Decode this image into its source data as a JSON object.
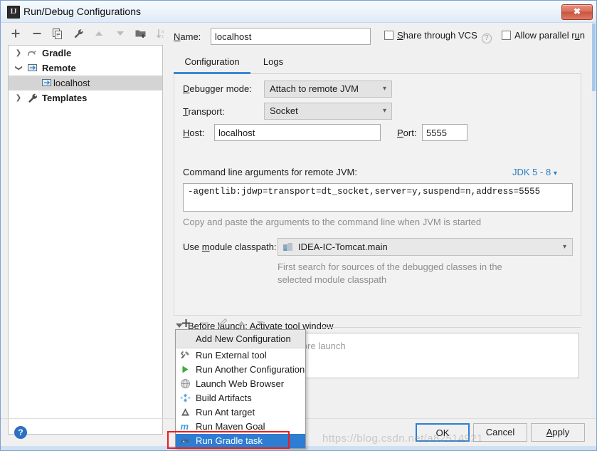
{
  "window": {
    "title": "Run/Debug Configurations",
    "app_icon": "IJ",
    "close_label": "✖"
  },
  "left_toolbar": {
    "buttons": [
      {
        "name": "add-configuration-button",
        "icon": "plus-icon",
        "glyph": "+",
        "enabled": true
      },
      {
        "name": "remove-configuration-button",
        "icon": "minus-icon",
        "glyph": "−",
        "enabled": true
      },
      {
        "name": "copy-configuration-button",
        "icon": "copy-icon",
        "glyph": "",
        "enabled": true
      },
      {
        "name": "edit-templates-button",
        "icon": "wrench-icon",
        "glyph": "",
        "enabled": true
      },
      {
        "name": "move-up-button",
        "icon": "arrow-up-icon",
        "glyph": "▲",
        "enabled": false
      },
      {
        "name": "move-down-button",
        "icon": "arrow-down-icon",
        "glyph": "▼",
        "enabled": false
      },
      {
        "name": "new-folder-button",
        "icon": "folder-add-icon",
        "glyph": "",
        "enabled": true
      },
      {
        "name": "sort-alphabetically-button",
        "icon": "sort-az-icon",
        "glyph": "",
        "enabled": false
      }
    ]
  },
  "tree": {
    "items": [
      {
        "label": "Gradle",
        "icon": "gradle-elephant-icon",
        "expander": "collapsed",
        "depth": 0,
        "bold": true,
        "selected": false
      },
      {
        "label": "Remote",
        "icon": "remote-icon",
        "expander": "expanded",
        "depth": 0,
        "bold": true,
        "selected": false
      },
      {
        "label": "localhost",
        "icon": "remote-icon",
        "expander": "none",
        "depth": 1,
        "bold": false,
        "selected": true
      },
      {
        "label": "Templates",
        "icon": "wrench-icon",
        "expander": "collapsed",
        "depth": 0,
        "bold": true,
        "selected": false
      }
    ]
  },
  "header": {
    "name_label": "Name:",
    "name_label_mnemonic": "N",
    "name_value": "localhost",
    "share_vcs_label": "Share through VCS",
    "share_vcs_mnemonic": "S",
    "share_vcs_checked": false,
    "share_vcs_help_icon": "question-icon",
    "allow_parallel_label": "Allow parallel run",
    "allow_parallel_mnemonic": "u",
    "allow_parallel_checked": false
  },
  "tabs": [
    {
      "label": "Configuration",
      "active": true
    },
    {
      "label": "Logs",
      "active": false
    }
  ],
  "configuration": {
    "debugger_mode_label": "Debugger mode:",
    "debugger_mode_value": "Attach to remote JVM",
    "transport_label": "Transport:",
    "transport_value": "Socket",
    "host_label": "Host:",
    "host_value": "localhost",
    "port_label": "Port:",
    "port_value": "5555",
    "cmd_args_label": "Command line arguments for remote JVM:",
    "jdk_selector_label": "JDK 5 - 8",
    "cmd_args_value": "-agentlib:jdwp=transport=dt_socket,server=y,suspend=n,address=5555",
    "copy_hint": "Copy and paste the arguments to the command line when JVM is started",
    "module_classpath_label": "Use module classpath:",
    "module_classpath_value": "IDEA-IC-Tomcat.main",
    "module_classpath_icon": "module-icon",
    "module_hint": "First search for sources of the debugged classes in the selected module classpath"
  },
  "before_launch": {
    "title": "Before launch: Activate tool window",
    "title_mnemonic": "B",
    "toolbar": [
      {
        "name": "add-task-button",
        "icon": "plus-icon",
        "glyph": "+",
        "enabled": true
      },
      {
        "name": "remove-task-button",
        "icon": "minus-icon",
        "glyph": "−",
        "enabled": false
      },
      {
        "name": "edit-task-button",
        "icon": "pencil-icon",
        "glyph": "",
        "enabled": false
      },
      {
        "name": "move-task-up-button",
        "icon": "arrow-up-icon",
        "glyph": "▲",
        "enabled": false
      },
      {
        "name": "move-task-down-button",
        "icon": "arrow-down-icon",
        "glyph": "▼",
        "enabled": false
      }
    ],
    "empty_text": "There are no tasks to run before launch",
    "activate_tool_window_label": "Activate tool window",
    "activate_tool_window_checked": true
  },
  "menu": {
    "header": "Add New Configuration",
    "items": [
      {
        "label": "Run External tool",
        "icon": "external-tool-icon",
        "selected": false
      },
      {
        "label": "Run Another Configuration",
        "icon": "green-play-icon",
        "selected": false
      },
      {
        "label": "Launch Web Browser",
        "icon": "globe-icon",
        "selected": false
      },
      {
        "label": "Build Artifacts",
        "icon": "artifacts-diamond-icon",
        "selected": false
      },
      {
        "label": "Run Ant target",
        "icon": "ant-triangle-icon",
        "selected": false
      },
      {
        "label": "Run Maven Goal",
        "icon": "maven-m-icon",
        "selected": false
      },
      {
        "label": "Run Gradle task",
        "icon": "gradle-elephant-icon",
        "selected": true
      }
    ]
  },
  "footer": {
    "help_label": "?",
    "ok_label": "OK",
    "cancel_label": "Cancel",
    "apply_label": "Apply",
    "apply_mnemonic": "A"
  },
  "watermark": "https://blog.csdn.net/a82514921",
  "colors": {
    "accent_blue": "#2d7dd2",
    "tab_underline": "#3b87d6",
    "link_blue": "#2a7fc4",
    "highlight_red": "#ee1c1c",
    "selection_gray": "#d4d4d4"
  }
}
